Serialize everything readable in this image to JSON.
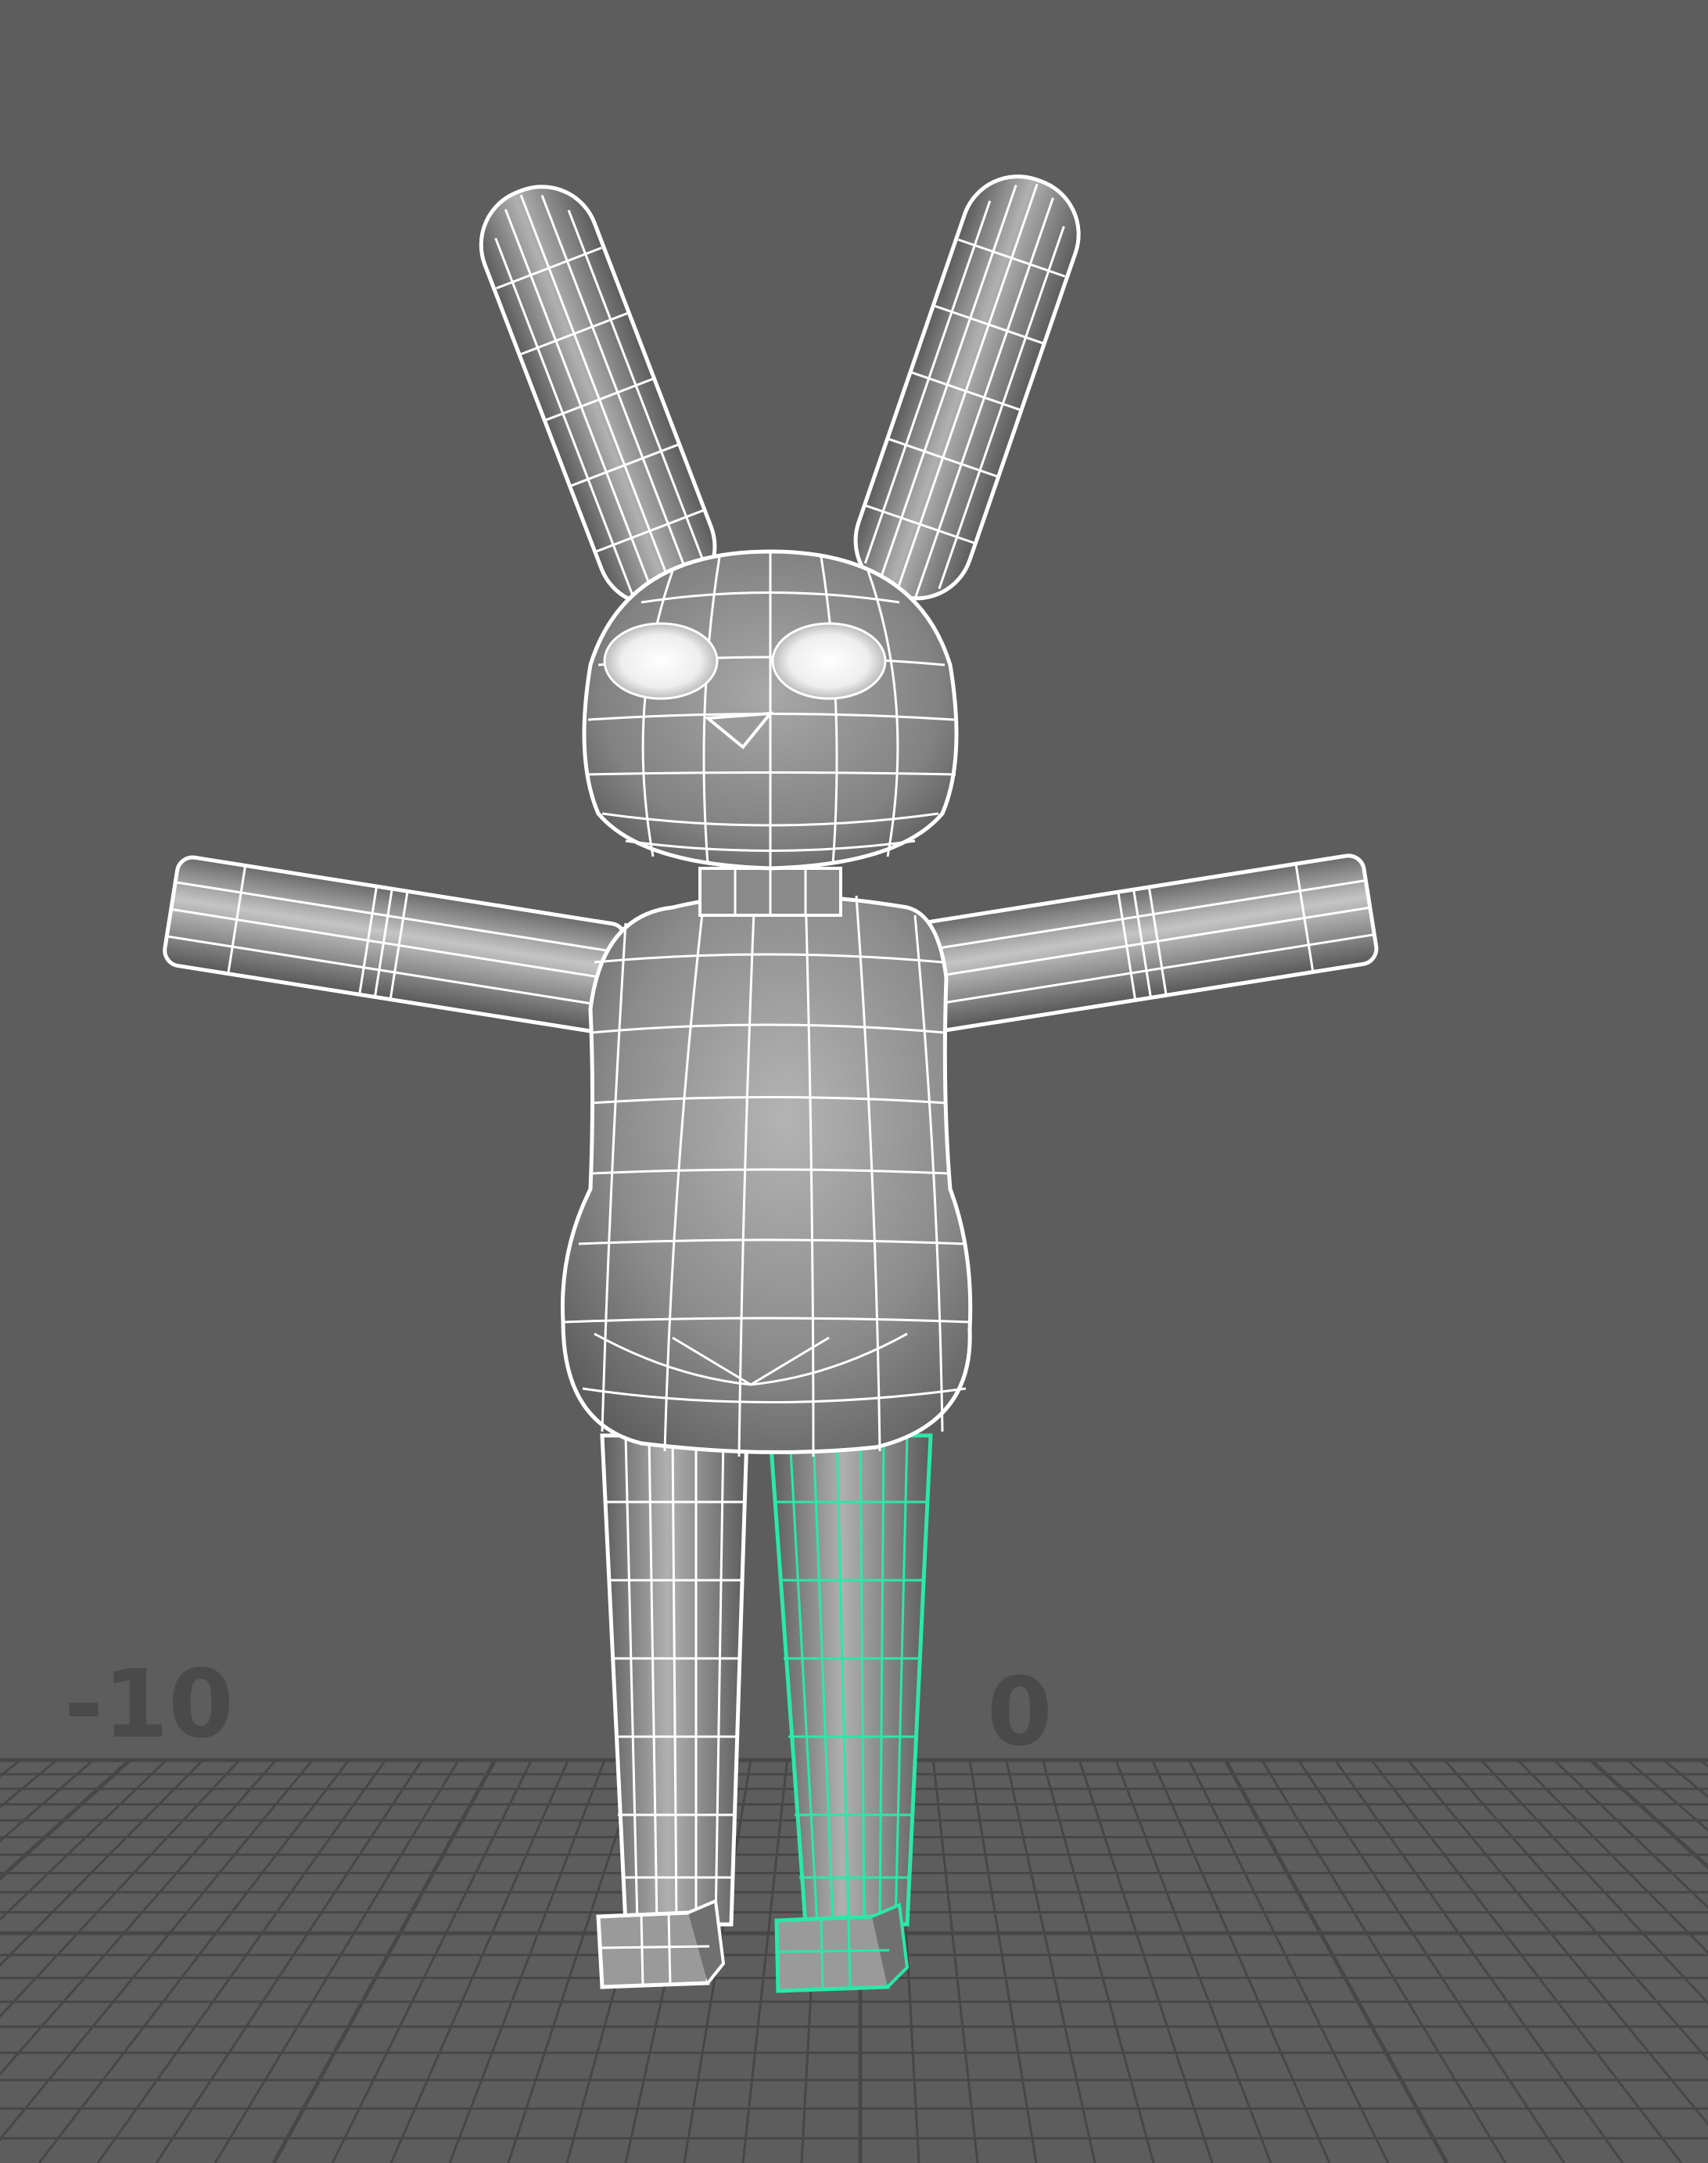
{
  "viewport": {
    "background_color": "#5d5d5d",
    "grid_color": "#474747",
    "grid_label_color": "#4a4a4a",
    "wire_color": "#ffffff",
    "selection_color": "#2be8a8",
    "grid_labels": {
      "neg_ten": "-10",
      "zero": "0"
    }
  },
  "model": {
    "name_icon": "bunny-mesh-icon",
    "parts": [
      "left-ear",
      "right-ear",
      "head",
      "left-arm",
      "right-arm",
      "body",
      "left-leg",
      "right-leg",
      "left-foot",
      "right-foot"
    ],
    "selected_part": "right-leg"
  }
}
